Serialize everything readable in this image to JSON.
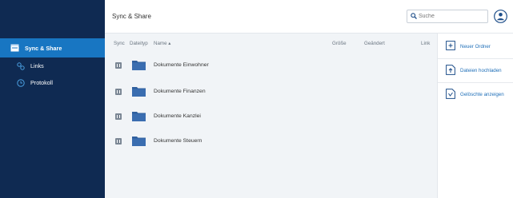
{
  "sidebar": {
    "items": [
      {
        "label": "Sync & Share",
        "icon": "sync-share-icon",
        "active": true
      },
      {
        "label": "Links",
        "icon": "link-icon",
        "active": false
      },
      {
        "label": "Protokoll",
        "icon": "clock-icon",
        "active": false
      }
    ]
  },
  "header": {
    "title": "Sync & Share",
    "search_placeholder": "Suche",
    "avatar_icon": "user-avatar-icon"
  },
  "table": {
    "columns": {
      "sync": "Sync",
      "type": "Dateityp",
      "name": "Name ▴",
      "size": "Größe",
      "changed": "Geändert",
      "link": "Link"
    },
    "rows": [
      {
        "name": "Dokumente Einwohner"
      },
      {
        "name": "Dokumente Finanzen"
      },
      {
        "name": "Dokumente Kanzlei"
      },
      {
        "name": "Dokumente Steuern"
      }
    ]
  },
  "actions": [
    {
      "label": "Neuer Ordner",
      "icon": "new-folder-icon"
    },
    {
      "label": "Dateien hochladen",
      "icon": "upload-file-icon"
    },
    {
      "label": "Gelöschte anzeigen",
      "icon": "show-deleted-icon"
    }
  ],
  "colors": {
    "sidebar_bg": "#0f2a52",
    "sidebar_active": "#1876c2",
    "folder": "#2f5f9e",
    "link": "#1f6fb8"
  }
}
